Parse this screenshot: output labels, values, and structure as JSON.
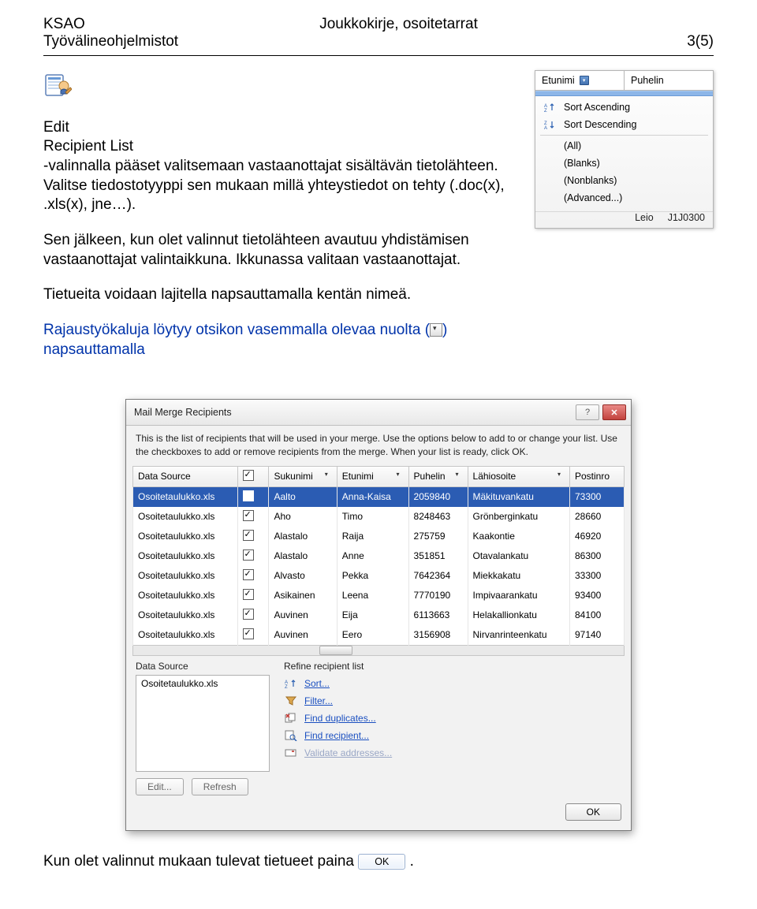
{
  "header": {
    "left1": "KSAO",
    "left2": "Työvälineohjelmistot",
    "center": "Joukkokirje, osoitetarrat",
    "right": "3(5)"
  },
  "editRL": {
    "line1": "Edit",
    "line2": "Recipient List"
  },
  "paragraphs": {
    "p1a": "-valinnalla pääset valitsemaan vastaanottajat sisältävän tietolähteen. Valitse tiedostotyyppi sen mukaan millä yhteystiedot on tehty (.doc(x), .xls(x), jne…).",
    "p2": "Sen jälkeen, kun olet valinnut tietolähteen avautuu yhdistämisen vastaanottajat valintaikkuna. Ikkunassa valitaan vastaanottajat.",
    "p3": " Tietueita voidaan lajitella napsauttamalla kentän nimeä.",
    "p4a": "Rajaustyökaluja löytyy otsikon vasemmalla olevaa nuolta (",
    "p4b": ") napsauttamalla"
  },
  "filterPanel": {
    "col1": "Etunimi",
    "col2": "Puhelin",
    "sortAsc": "Sort Ascending",
    "sortDesc": "Sort Descending",
    "all": "(All)",
    "blanks": "(Blanks)",
    "nonblanks": "(Nonblanks)",
    "advanced": "(Advanced...)",
    "extra1": "Leio",
    "extra2": "J1J0300"
  },
  "dialog": {
    "title": "Mail Merge Recipients",
    "intro": "This is the list of recipients that will be used in your merge. Use the options below to add to or change your list. Use the checkboxes to add or remove recipients from the merge. When your list is ready, click OK.",
    "cols": {
      "ds": "Data Source",
      "suku": "Sukunimi",
      "etu": "Etunimi",
      "puh": "Puhelin",
      "lahi": "Lähiosoite",
      "post": "Postinro"
    },
    "rows": [
      {
        "ds": "Osoitetaulukko.xls",
        "s": "Aalto",
        "e": "Anna-Kaisa",
        "p": "2059840",
        "l": "Mäkituvankatu",
        "po": "73300"
      },
      {
        "ds": "Osoitetaulukko.xls",
        "s": "Aho",
        "e": "Timo",
        "p": "8248463",
        "l": "Grönberginkatu",
        "po": "28660"
      },
      {
        "ds": "Osoitetaulukko.xls",
        "s": "Alastalo",
        "e": "Raija",
        "p": "275759",
        "l": "Kaakontie",
        "po": "46920"
      },
      {
        "ds": "Osoitetaulukko.xls",
        "s": "Alastalo",
        "e": "Anne",
        "p": "351851",
        "l": "Otavalankatu",
        "po": "86300"
      },
      {
        "ds": "Osoitetaulukko.xls",
        "s": "Alvasto",
        "e": "Pekka",
        "p": "7642364",
        "l": "Miekkakatu",
        "po": "33300"
      },
      {
        "ds": "Osoitetaulukko.xls",
        "s": "Asikainen",
        "e": "Leena",
        "p": "7770190",
        "l": "Impivaarankatu",
        "po": "93400"
      },
      {
        "ds": "Osoitetaulukko.xls",
        "s": "Auvinen",
        "e": "Eija",
        "p": "6113663",
        "l": "Helakallionkatu",
        "po": "84100"
      },
      {
        "ds": "Osoitetaulukko.xls",
        "s": "Auvinen",
        "e": "Eero",
        "p": "3156908",
        "l": "Nirvanrinteenkatu",
        "po": "97140"
      }
    ],
    "dsLabel": "Data Source",
    "dsItem": "Osoitetaulukko.xls",
    "editBtn": "Edit...",
    "refreshBtn": "Refresh",
    "refineLabel": "Refine recipient list",
    "sort": "Sort...",
    "filter": "Filter...",
    "dup": "Find duplicates...",
    "find": "Find recipient...",
    "validate": "Validate addresses...",
    "ok": "OK"
  },
  "last": {
    "a": "Kun olet valinnut mukaan tulevat tietueet paina ",
    "okLabel": "OK",
    "b": "."
  }
}
